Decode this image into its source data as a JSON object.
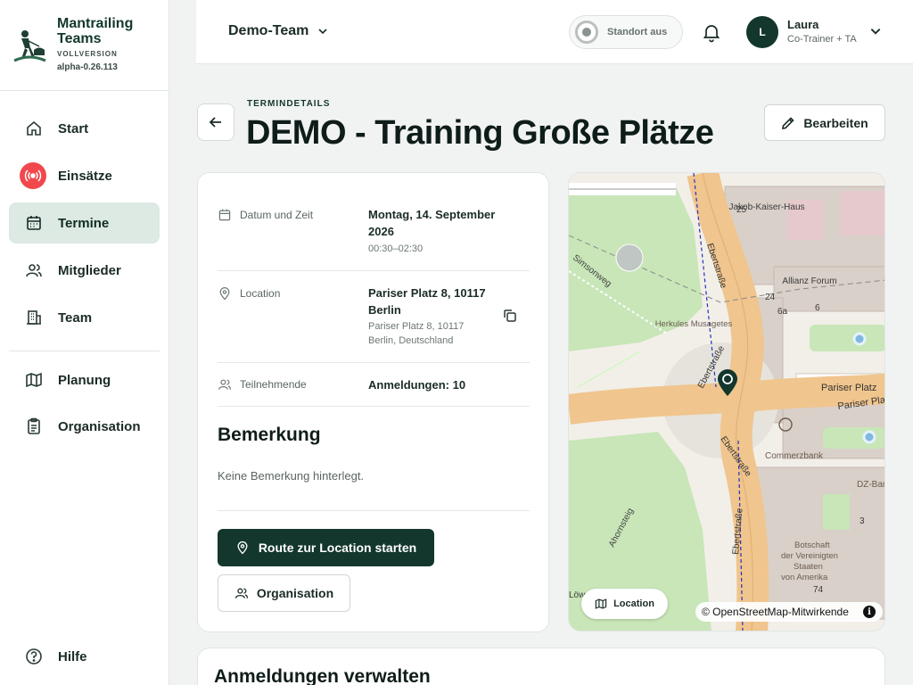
{
  "brand": {
    "name": "Mantrailing Teams",
    "edition": "VOLLVERSION",
    "version": "alpha-0.26.113"
  },
  "sidebar": {
    "items": [
      {
        "label": "Start",
        "icon": "home-icon"
      },
      {
        "label": "Einsätze",
        "icon": "siren-icon"
      },
      {
        "label": "Termine",
        "icon": "calendar-icon",
        "active": true
      },
      {
        "label": "Mitglieder",
        "icon": "users-icon"
      },
      {
        "label": "Team",
        "icon": "building-icon"
      },
      {
        "label": "Planung",
        "icon": "map-icon"
      },
      {
        "label": "Organisation",
        "icon": "clipboard-icon"
      }
    ],
    "help": "Hilfe"
  },
  "topbar": {
    "team": "Demo-Team",
    "location_toggle": "Standort aus",
    "user": {
      "initial": "L",
      "name": "Laura",
      "role": "Co-Trainer + TA"
    }
  },
  "header": {
    "eyebrow": "TERMINDETAILS",
    "title": "DEMO - Training Große Plätze",
    "edit_label": "Bearbeiten"
  },
  "details": {
    "date_label": "Datum und Zeit",
    "date_value": "Montag, 14. September 2026",
    "time_value": "00:30–02:30",
    "location_label": "Location",
    "location_value": "Pariser Platz 8, 10117 Berlin",
    "location_sub": "Pariser Platz 8, 10117 Berlin, Deutschland",
    "participants_label": "Teilnehmende",
    "participants_value": "Anmeldungen: 10",
    "remark_heading": "Bemerkung",
    "remark_text": "Keine Bemerkung hinterlegt.",
    "route_button": "Route zur Location starten",
    "organisation_button": "Organisation"
  },
  "map": {
    "location_button": "Location",
    "attribution": "© OpenStreetMap-Mitwirkende",
    "labels": {
      "jakob": "Jakob-Kaiser-Haus",
      "allianz": "Allianz Forum",
      "herkules": "Herkules Musagetes",
      "simsonweg": "Simsonweg",
      "ebert1": "Ebertstraße",
      "ebert2": "Ebertstraße",
      "ebert3": "Ebertstraße",
      "ebert4": "Ebertstraße",
      "pariser1": "Pariser Platz",
      "pariser2": "Pariser Pla",
      "commerzbank": "Commerzbank",
      "dzbank": "DZ-Bar",
      "botschaft": "Botschaft der Vereinigten Staaten von Amerika",
      "ahornsteig": "Ahornsteig",
      "num25": "25",
      "num24": "24",
      "num6a": "6a",
      "num6": "6",
      "num3": "3",
      "num74": "74",
      "lowe": "Löw"
    }
  },
  "bottom": {
    "heading": "Anmeldungen verwalten"
  },
  "colors": {
    "primary": "#13372d",
    "active_nav": "#dde9e3",
    "siren": "#f0484d"
  }
}
